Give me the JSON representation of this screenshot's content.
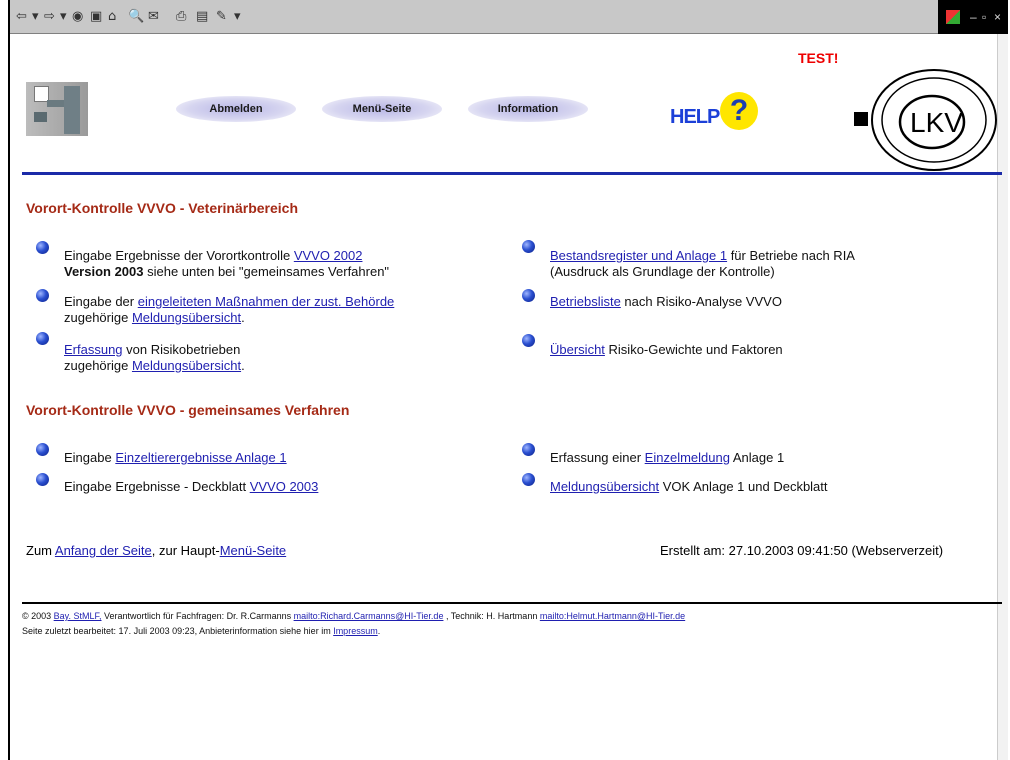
{
  "toolbar": {
    "items": [
      "⇦",
      "▾",
      "⇨",
      "▾",
      "◉",
      "▣",
      "⌂",
      "🔍",
      "✉",
      "⎙",
      "▤",
      "✎",
      "▾"
    ],
    "right_icons": [
      "–",
      "▫",
      "×"
    ]
  },
  "header": {
    "test_label": "TEST!",
    "nav": [
      "Abmelden",
      "Menü-Seite",
      "Information"
    ],
    "help_text": "HELP",
    "help_q": "?",
    "lkv_text": "LKV"
  },
  "section1": {
    "title": "Vorort-Kontrolle VVVO - Veterinärbereich",
    "left": [
      {
        "pre": "Eingabe Ergebnisse der Vorortkontrolle ",
        "link": "VVVO 2002",
        "post": "",
        "line2_bold": "Version 2003",
        "line2": " siehe unten bei \"gemeinsames Verfahren\"",
        "line2_link": "",
        "line2_post": ""
      },
      {
        "pre": "Eingabe der ",
        "link": "eingeleiteten Maßnahmen der zust. Behörde",
        "post": "",
        "line2_bold": "",
        "line2": "zugehörige ",
        "line2_link": "Meldungsübersicht",
        "line2_post": "."
      },
      {
        "pre": "",
        "link": "Erfassung",
        "post": " von Risikobetrieben",
        "line2_bold": "",
        "line2": "zugehörige ",
        "line2_link": "Meldungsübersicht",
        "line2_post": "."
      }
    ],
    "right": [
      {
        "pre": "",
        "link": "Bestandsregister und Anlage 1",
        "post": " für Betriebe nach RIA",
        "line2": "(Ausdruck als Grundlage der Kontrolle)"
      },
      {
        "pre": "",
        "link": "Betriebsliste",
        "post": " nach Risiko-Analyse VVVO",
        "line2": ""
      },
      {
        "pre": "",
        "link": "Übersicht",
        "post": " Risiko-Gewichte und Faktoren",
        "line2": ""
      }
    ]
  },
  "section2": {
    "title": "Vorort-Kontrolle VVVO - gemeinsames Verfahren",
    "left": [
      {
        "pre": "Eingabe ",
        "link": "Einzeltierergebnisse Anlage 1",
        "post": ""
      },
      {
        "pre": "Eingabe Ergebnisse - Deckblatt ",
        "link": "VVVO 2003",
        "post": ""
      }
    ],
    "right": [
      {
        "pre": "Erfassung einer ",
        "link": "Einzelmeldung",
        "post": " Anlage 1"
      },
      {
        "pre": "",
        "link": "Meldungsübersicht",
        "post": " VOK Anlage 1 und Deckblatt"
      }
    ]
  },
  "footer": {
    "pre1": "Zum ",
    "link1": "Anfang der Seite",
    "mid": ",   zur Haupt-",
    "link2": "Menü-Seite",
    "created": "Erstellt am: 27.10.2003 09:41:50 (Webserverzeit)"
  },
  "bottom": {
    "line1_pre": "© 2003 ",
    "line1_link1": "Bay. StMLF,",
    "line1_mid": " Verantwortlich für Fachfragen: Dr. R.Carmanns ",
    "line1_link2": "mailto:Richard.Carmanns@HI-Tier.de",
    "line1_mid2": " , Technik: H. Hartmann ",
    "line1_link3": "mailto:Helmut.Hartmann@HI-Tier.de",
    "line2_pre": "Seite zuletzt bearbeitet: 17. Juli 2003 09:23, Anbieterinformation siehe hier im ",
    "line2_link": "Impressum",
    "line2_post": "."
  },
  "colors": {
    "heading": "#a52a16",
    "rule": "#1b2aa8",
    "link": "#1f1fb0",
    "test": "#e00000",
    "help": "#1c40d8"
  }
}
